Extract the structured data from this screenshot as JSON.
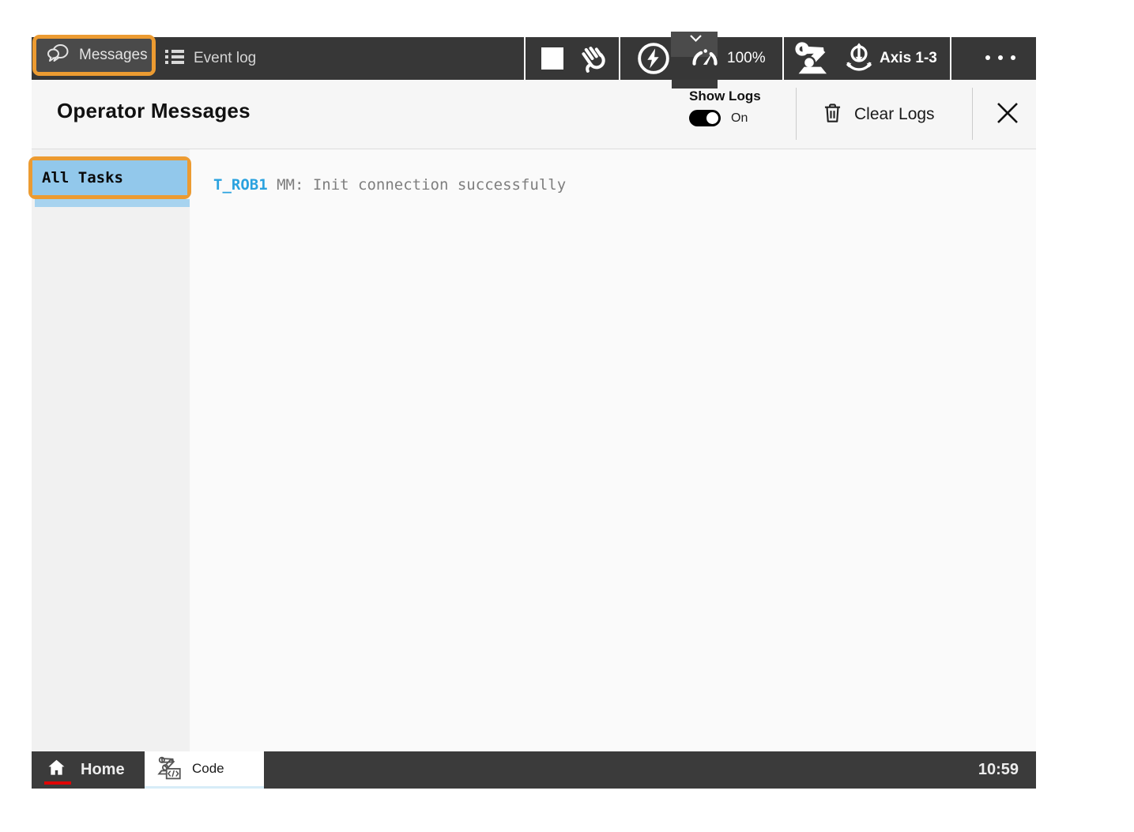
{
  "toolbar": {
    "messages_label": "Messages",
    "event_log_label": "Event log",
    "speed_value": "100%",
    "axis_label": "Axis 1-3"
  },
  "header": {
    "title": "Operator Messages",
    "show_logs_label": "Show Logs",
    "show_logs_state": "On",
    "clear_logs_label": "Clear Logs"
  },
  "sidebar": {
    "items": [
      {
        "label": "All Tasks",
        "selected": true
      }
    ]
  },
  "messages": [
    {
      "task": "T_ROB1",
      "text": "MM: Init connection successfully"
    }
  ],
  "taskbar": {
    "home_label": "Home",
    "tabs": [
      {
        "label": "Code",
        "active": true
      }
    ],
    "time": "10:59"
  },
  "colors": {
    "accent_orange": "#EC9B31",
    "selection_blue": "#92C8EB",
    "task_name_blue": "#2AA2DF",
    "taskbar_red": "#E00505",
    "toolbar_bg": "#373737"
  }
}
